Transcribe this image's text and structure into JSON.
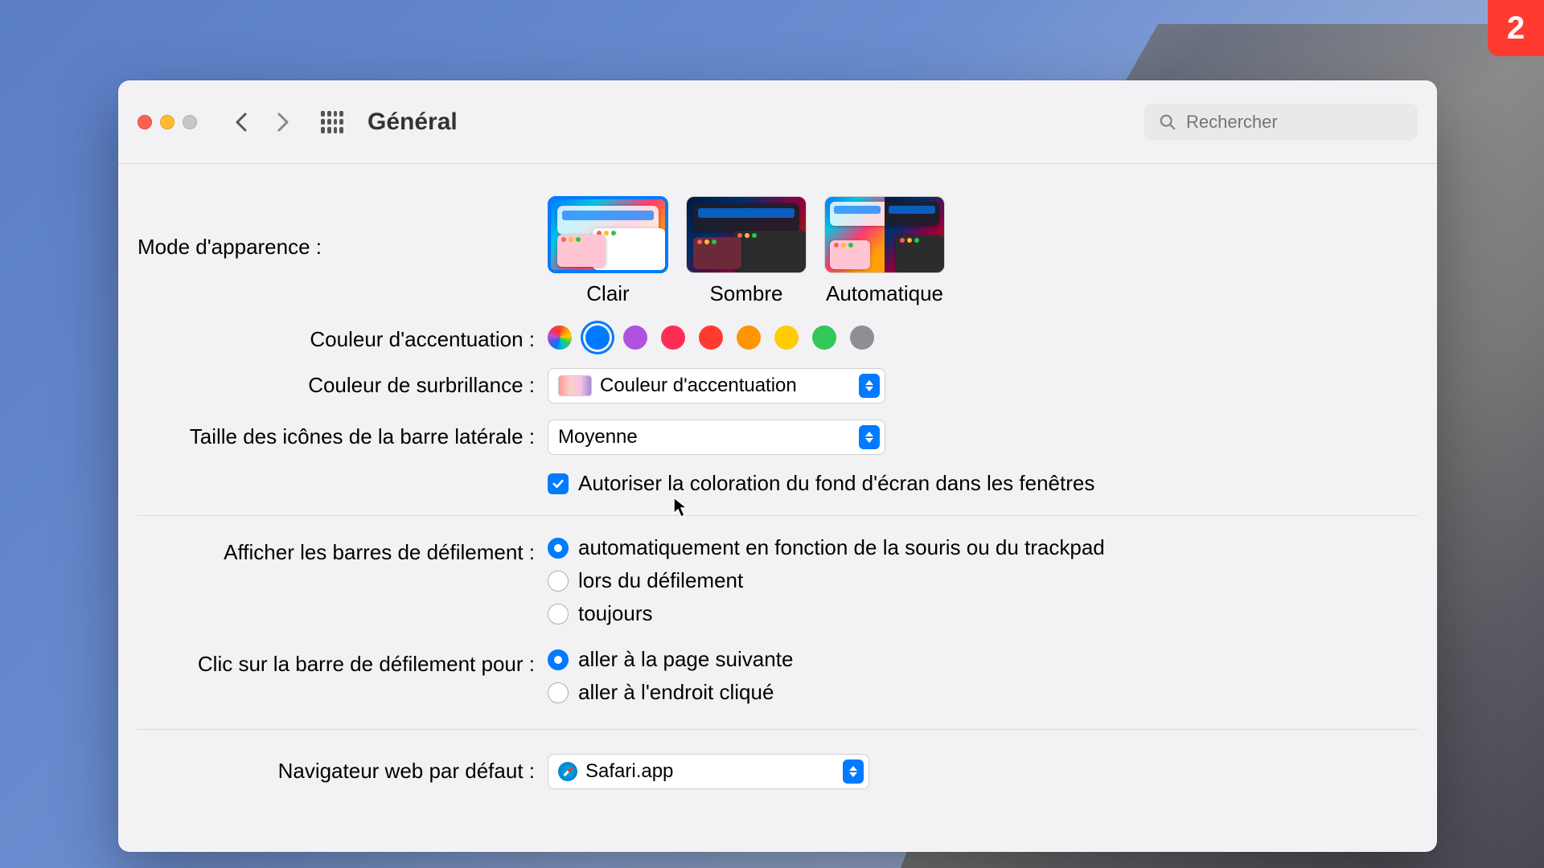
{
  "badge": "2",
  "window": {
    "title": "Général",
    "search_placeholder": "Rechercher"
  },
  "appearance": {
    "label": "Mode d'apparence :",
    "options": [
      {
        "label": "Clair",
        "selected": true
      },
      {
        "label": "Sombre",
        "selected": false
      },
      {
        "label": "Automatique",
        "selected": false
      }
    ]
  },
  "accent": {
    "label": "Couleur d'accentuation :",
    "colors": [
      "rainbow",
      "blue",
      "purple",
      "pink",
      "red",
      "orange",
      "yellow",
      "green",
      "gray"
    ],
    "selected": "blue"
  },
  "highlight": {
    "label": "Couleur de surbrillance :",
    "value": "Couleur d'accentuation"
  },
  "sidebar_size": {
    "label": "Taille des icônes de la barre latérale :",
    "value": "Moyenne"
  },
  "tinting": {
    "label": "Autoriser la coloration du fond d'écran dans les fenêtres",
    "checked": true
  },
  "scrollbars": {
    "label": "Afficher les barres de défilement :",
    "options": [
      {
        "label": "automatiquement en fonction de la souris ou du trackpad",
        "checked": true
      },
      {
        "label": "lors du défilement",
        "checked": false
      },
      {
        "label": "toujours",
        "checked": false
      }
    ]
  },
  "scrollclick": {
    "label": "Clic sur la barre de défilement pour :",
    "options": [
      {
        "label": "aller à la page suivante",
        "checked": true
      },
      {
        "label": "aller à l'endroit cliqué",
        "checked": false
      }
    ]
  },
  "default_browser": {
    "label": "Navigateur web par défaut :",
    "value": "Safari.app"
  }
}
